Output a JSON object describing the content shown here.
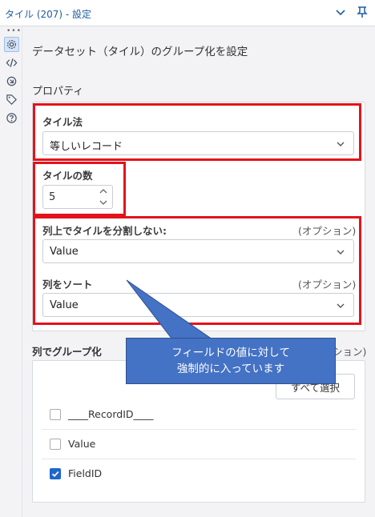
{
  "window": {
    "title": "タイル (207) - 設定"
  },
  "heading": "データセット（タイル）のグループ化を設定",
  "properties": {
    "section_title": "プロパティ",
    "tile_method": {
      "label": "タイル法",
      "value": "等しいレコード"
    },
    "tile_count": {
      "label": "タイルの数",
      "value": "5"
    },
    "no_split": {
      "label": "列上でタイルを分割しない:",
      "optional": "(オプション)",
      "value": "Value"
    },
    "sort_by": {
      "label": "列をソート",
      "optional": "(オプション)",
      "value": "Value"
    }
  },
  "group_by": {
    "label": "列でグループ化",
    "optional": "ション)",
    "select_all": "すべて選択",
    "fields": [
      {
        "name": "____RecordID____",
        "checked": false
      },
      {
        "name": "Value",
        "checked": false
      },
      {
        "name": "FieldID",
        "checked": true
      }
    ]
  },
  "callout": {
    "line1": "フィールドの値に対して",
    "line2": "強制的に入っています"
  },
  "colors": {
    "accent": "#1e66c9",
    "highlight": "#e3131b",
    "callout": "#4472c4"
  }
}
